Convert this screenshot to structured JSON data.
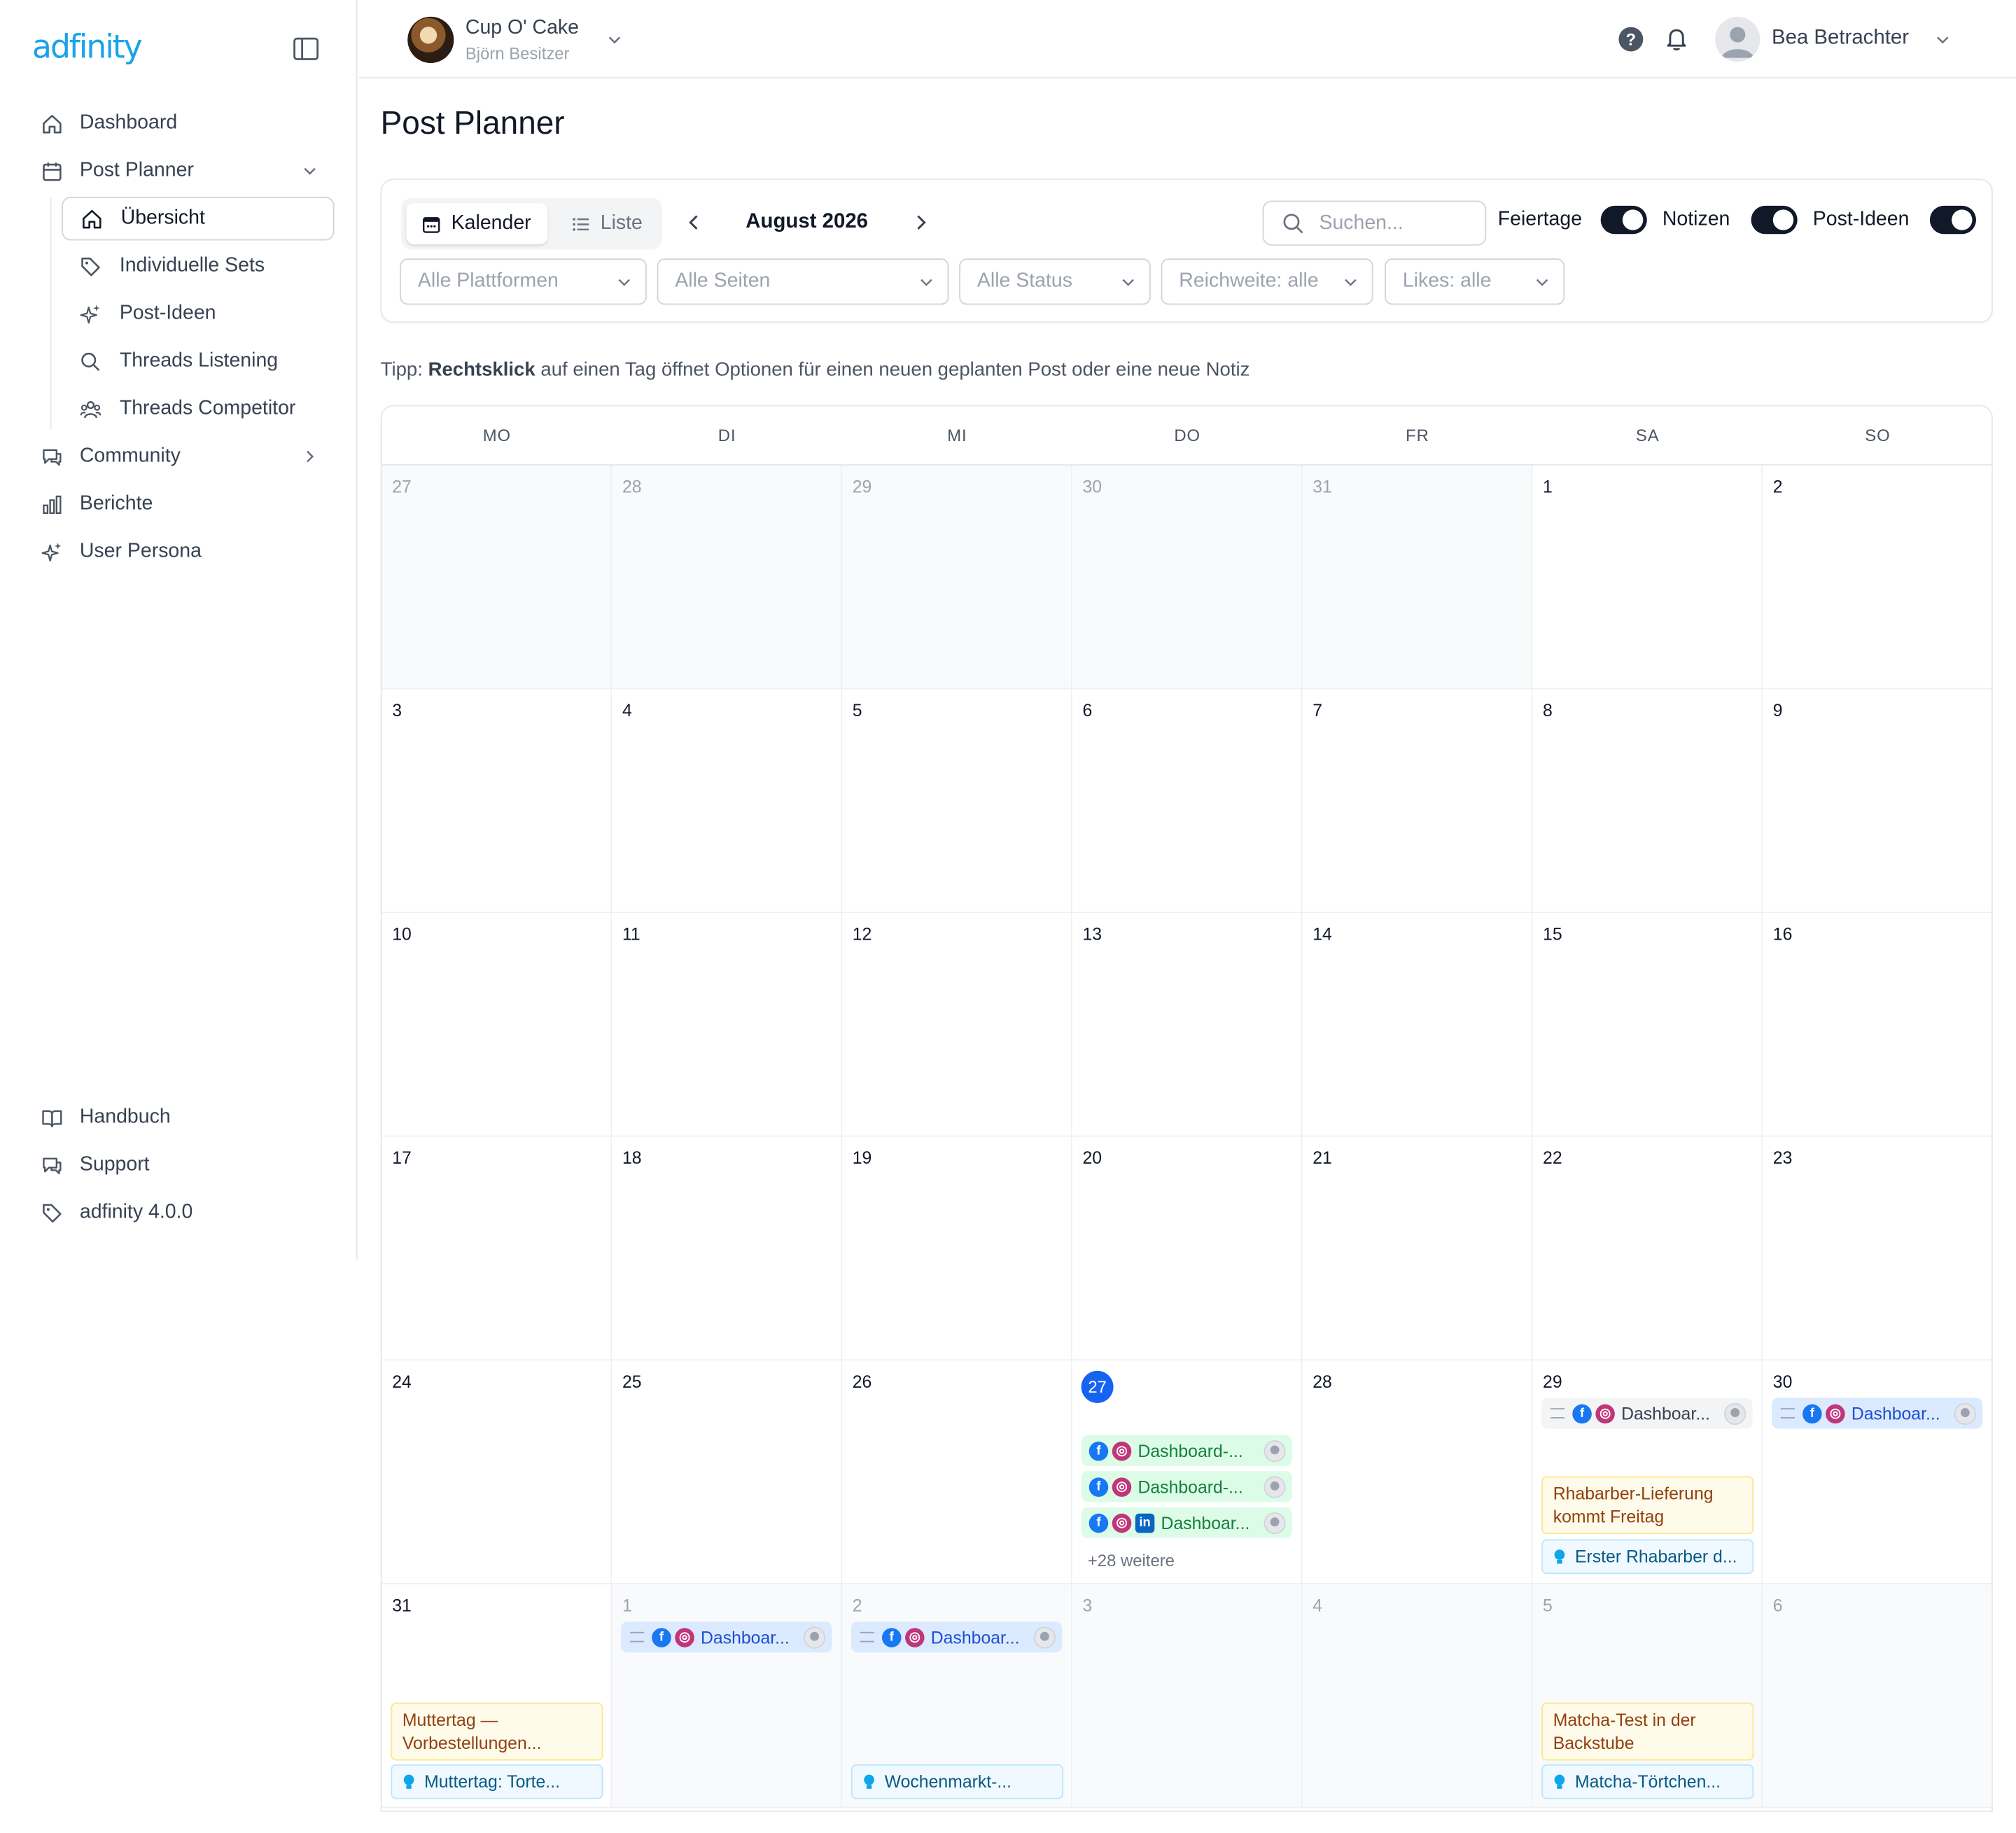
{
  "app": {
    "logo_text": "adfinity",
    "brand": {
      "name": "Cup O' Cake",
      "owner": "Björn Besitzer"
    },
    "user": {
      "name": "Bea Betrachter"
    },
    "help_label": "?"
  },
  "sidebar": {
    "items": [
      {
        "label": "Dashboard",
        "icon": "home-icon"
      },
      {
        "label": "Post Planner",
        "icon": "calendar-icon",
        "expanded": true
      },
      {
        "label": "Community",
        "icon": "chat-icon"
      },
      {
        "label": "Berichte",
        "icon": "bar-chart-icon"
      },
      {
        "label": "User Persona",
        "icon": "sparkles-icon"
      }
    ],
    "sub_items": [
      {
        "label": "Übersicht",
        "icon": "home-icon",
        "active": true
      },
      {
        "label": "Individuelle Sets",
        "icon": "tag-icon"
      },
      {
        "label": "Post-Ideen",
        "icon": "sparkles-icon"
      },
      {
        "label": "Threads Listening",
        "icon": "search-icon"
      },
      {
        "label": "Threads Competitor",
        "icon": "users-icon"
      }
    ],
    "bottom_items": [
      {
        "label": "Handbuch",
        "icon": "book-icon"
      },
      {
        "label": "Support",
        "icon": "chat-icon"
      },
      {
        "label": "adfinity 4.0.0",
        "icon": "tag-icon"
      }
    ]
  },
  "page": {
    "title": "Post Planner",
    "tip_prefix": "Tipp: ",
    "tip_bold": "Rechtsklick",
    "tip_suffix": " auf einen Tag öffnet Optionen für einen neuen geplanten Post oder eine neue Notiz"
  },
  "toolbar": {
    "view_calendar": "Kalender",
    "view_list": "Liste",
    "active_view": "Kalender",
    "month": "August 2026",
    "search_placeholder": "Suchen...",
    "toggles": [
      {
        "label": "Feiertage",
        "on": true
      },
      {
        "label": "Notizen",
        "on": true
      },
      {
        "label": "Post-Ideen",
        "on": true
      }
    ],
    "filters": [
      "Alle Plattformen",
      "Alle Seiten",
      "Alle Status",
      "Reichweite: alle",
      "Likes: alle"
    ]
  },
  "calendar": {
    "weekdays": [
      "MO",
      "DI",
      "MI",
      "DO",
      "FR",
      "SA",
      "SO"
    ],
    "weeks": [
      [
        "27",
        "28",
        "29",
        "30",
        "31",
        "1",
        "2"
      ],
      [
        "3",
        "4",
        "5",
        "6",
        "7",
        "8",
        "9"
      ],
      [
        "10",
        "11",
        "12",
        "13",
        "14",
        "15",
        "16"
      ],
      [
        "17",
        "18",
        "19",
        "20",
        "21",
        "22",
        "23"
      ],
      [
        "24",
        "25",
        "26",
        "27",
        "28",
        "29",
        "30"
      ],
      [
        "31",
        "1",
        "2",
        "3",
        "4",
        "5",
        "6"
      ]
    ],
    "today": "27",
    "events": {
      "thu27": [
        "Dashboard-...",
        "Dashboard-...",
        "Dashboar..."
      ],
      "thu27_more": "+28 weitere",
      "sat29_post": "Dashboar...",
      "sat29_note": "Rhabarber-Lieferung kommt Freitag",
      "sat29_idea": "Erster Rhabarber d...",
      "sun30_post": "Dashboar...",
      "mon31_note": "Muttertag — Vorbestellungen...",
      "mon31_idea": "Muttertag: Torte...",
      "tue1_post": "Dashboar...",
      "wed2_post": "Dashboar...",
      "wed2_idea": "Wochenmarkt-...",
      "sat5_note": "Matcha-Test in der Backstube",
      "sat5_idea": "Matcha-Törtchen..."
    },
    "platform_glyphs": {
      "facebook": "f",
      "instagram": "◎",
      "linkedin": "in"
    }
  }
}
